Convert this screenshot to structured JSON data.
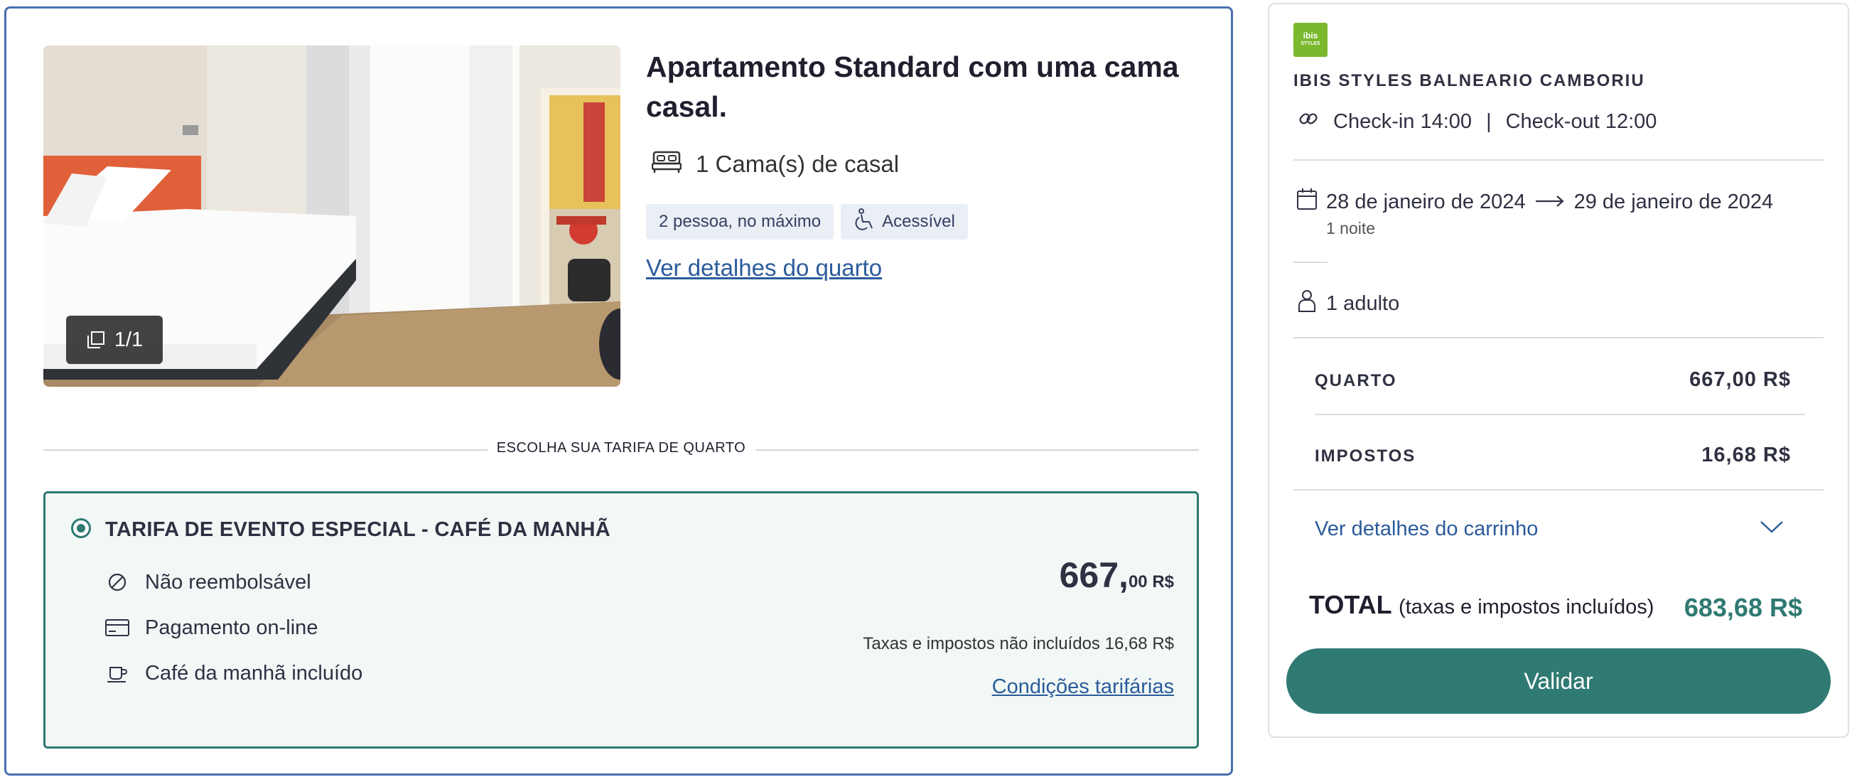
{
  "room": {
    "title": "Apartamento Standard com uma cama casal.",
    "bed": "1 Cama(s) de casal",
    "photo_counter": "1/1",
    "tags": [
      "2 pessoa, no máximo",
      "Acessível"
    ],
    "details_link": "Ver detalhes do quarto"
  },
  "rate_section": {
    "heading": "ESCOLHA SUA TARIFA DE QUARTO",
    "rate": {
      "name": "TARIFA DE EVENTO ESPECIAL - CAFÉ DA MANHÃ",
      "features": [
        "Não reembolsável",
        "Pagamento on-line",
        "Café da manhã incluído"
      ],
      "price_integer": "667,",
      "price_decimal": "00 R$",
      "tax_note": "Taxas e impostos não incluídos 16,68 R$",
      "conditions_link": "Condições tarifárias",
      "selected": true
    }
  },
  "summary": {
    "logo_text_top": "ibis",
    "logo_text_bottom": "STYLES",
    "hotel_name": "IBIS STYLES BALNEARIO CAMBORIU",
    "checkin": "Check-in 14:00",
    "separator": "|",
    "checkout": "Check-out 12:00",
    "date_from": "28 de janeiro de 2024",
    "date_to": "29 de janeiro de 2024",
    "nights": "1 noite",
    "guests": "1 adulto",
    "room_label": "QUARTO",
    "room_value": "667,00 R$",
    "taxes_label": "IMPOSTOS",
    "taxes_value": "16,68 R$",
    "cart_link": "Ver detalhes do carrinho",
    "total_label": "TOTAL",
    "total_sub": "(taxas e impostos incluídos)",
    "total_value": "683,68 R$",
    "validate_label": "Validar"
  },
  "colors": {
    "accent_teal": "#2f7a72",
    "link_blue": "#2b5b9b",
    "card_border_blue": "#4a6fb0"
  }
}
